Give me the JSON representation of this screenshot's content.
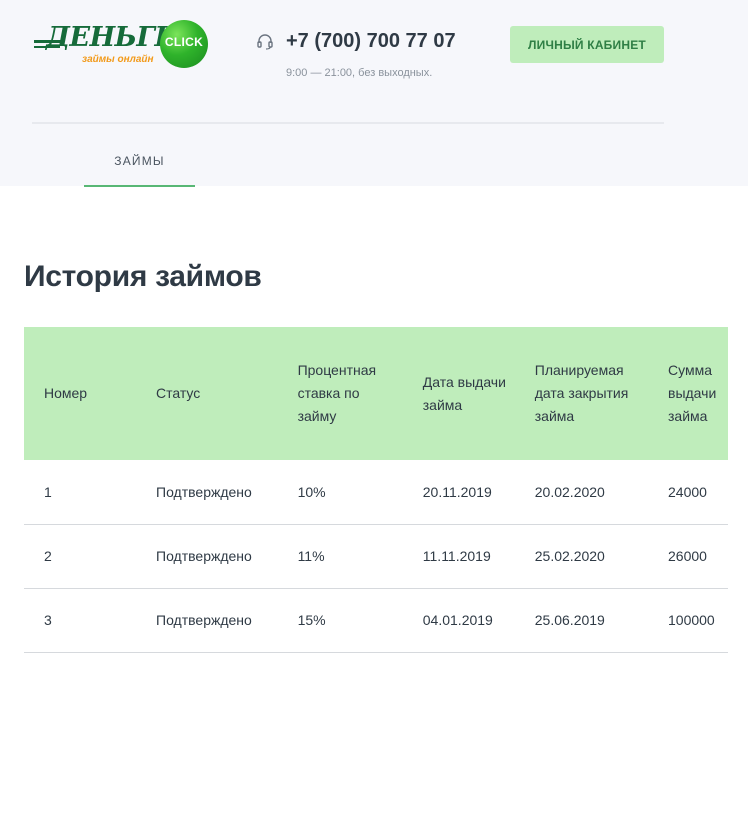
{
  "header": {
    "logo": {
      "brand": "ДЕНЬГИ",
      "badge": "CLICK",
      "tagline": "займы онлайн"
    },
    "phone": "+7 (700) 700 77 07",
    "hours": "9:00 — 21:00, без выходных.",
    "cabinet_button": "ЛИЧНЫЙ КАБИНЕТ",
    "phone_icon": "headset-icon"
  },
  "nav": {
    "tabs": [
      {
        "label": "ЗАЙМЫ",
        "active": true
      }
    ]
  },
  "colors": {
    "accent_green": "#bfedbb",
    "accent_text": "#2f7f45",
    "underline": "#58b775",
    "header_bg": "#f6f7fb"
  },
  "main": {
    "title": "История займов",
    "table": {
      "headers": [
        "Номер",
        "Статус",
        "Процентная ставка по займу",
        "Дата выдачи займа",
        "Планируемая дата закрытия займа",
        "Сумма выдачи займа"
      ],
      "rows": [
        [
          "1",
          "Подтверждено",
          "10%",
          "20.11.2019",
          "20.02.2020",
          "24000"
        ],
        [
          "2",
          "Подтверждено",
          "11%",
          "11.11.2019",
          "25.02.2020",
          "26000"
        ],
        [
          "3",
          "Подтверждено",
          "15%",
          "04.01.2019",
          "25.06.2019",
          "100000"
        ]
      ]
    }
  }
}
